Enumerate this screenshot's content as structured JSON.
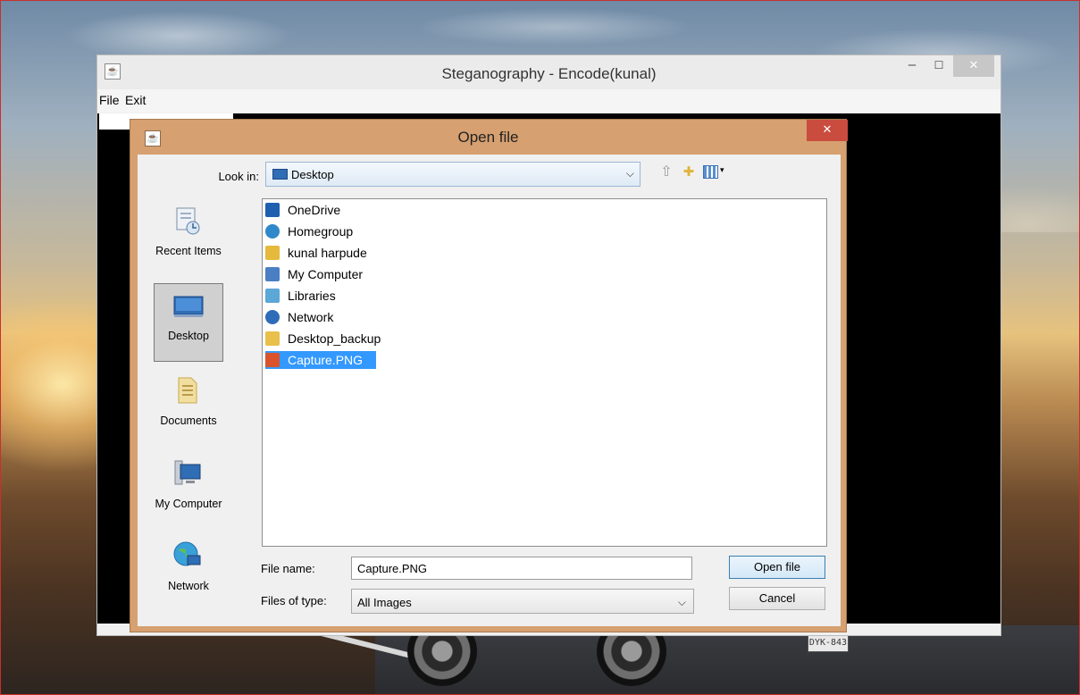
{
  "desktop": {
    "car_plate": "DYK-843"
  },
  "app": {
    "title": "Steganography - Encode(kunal)",
    "java_icon": "java-icon",
    "menu": [
      "File",
      "Exit"
    ],
    "window_buttons": {
      "minimize": "–",
      "maximize": "☐",
      "close": "✕"
    }
  },
  "dialog": {
    "title": "Open file",
    "close": "✕",
    "look_in": {
      "label": "Look in:",
      "value": "Desktop",
      "arrow": "⌵"
    },
    "places": [
      {
        "label": "Recent Items",
        "icon": "recent-items-icon"
      },
      {
        "label": "Desktop",
        "icon": "desktop-icon",
        "selected": true
      },
      {
        "label": "Documents",
        "icon": "documents-icon"
      },
      {
        "label": "My Computer",
        "icon": "my-computer-icon"
      },
      {
        "label": "Network",
        "icon": "network-icon"
      }
    ],
    "files": [
      {
        "name": "OneDrive",
        "icon": "onedrive-icon",
        "color": "#1e5fb0"
      },
      {
        "name": "Homegroup",
        "icon": "homegroup-icon",
        "color": "#2e88c9"
      },
      {
        "name": "kunal harpude",
        "icon": "user-folder-icon",
        "color": "#e5b93c"
      },
      {
        "name": "My Computer",
        "icon": "computer-icon",
        "color": "#4a7fc4"
      },
      {
        "name": "Libraries",
        "icon": "libraries-icon",
        "color": "#5aa7d8"
      },
      {
        "name": "Network",
        "icon": "network-icon",
        "color": "#2e6cb8"
      },
      {
        "name": "Desktop_backup",
        "icon": "folder-icon",
        "color": "#e8c04a"
      },
      {
        "name": "Capture.PNG",
        "icon": "image-file-icon",
        "color": "#d9532c",
        "selected": true
      }
    ],
    "file_name": {
      "label": "File name:",
      "value": "Capture.PNG"
    },
    "files_of_type": {
      "label": "Files of type:",
      "value": "All Images",
      "arrow": "⌵"
    },
    "buttons": {
      "open": "Open file",
      "cancel": "Cancel"
    }
  }
}
